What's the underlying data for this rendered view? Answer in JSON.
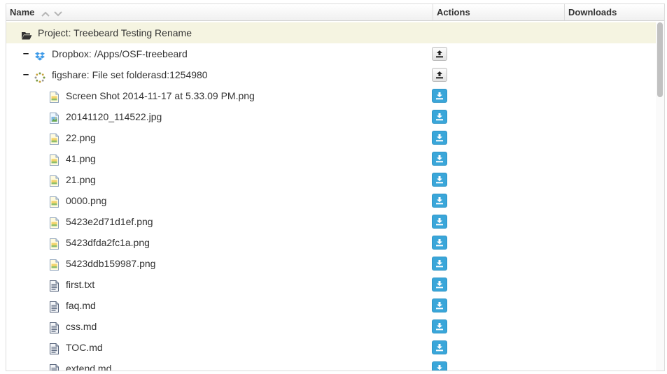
{
  "header": {
    "name": "Name",
    "actions": "Actions",
    "downloads": "Downloads",
    "sort_up_icon": "chevron-up-icon",
    "sort_down_icon": "chevron-down-icon"
  },
  "project": {
    "label": "Project: Treebeard Testing Rename",
    "icon": "folder-open-icon"
  },
  "providers": [
    {
      "label": "Dropbox: /Apps/OSF-treebeard",
      "toggle": "–",
      "icon": "dropbox-icon",
      "action": "upload-icon"
    },
    {
      "label": "figshare: File set folderasd:1254980",
      "toggle": "–",
      "icon": "figshare-icon",
      "action": "upload-icon"
    }
  ],
  "files": [
    {
      "label": "Screen Shot 2014-11-17 at 5.33.09 PM.png",
      "icon": "image-file-icon"
    },
    {
      "label": "20141120_114522.jpg",
      "icon": "photo-file-icon"
    },
    {
      "label": "22.png",
      "icon": "image-file-icon"
    },
    {
      "label": "41.png",
      "icon": "image-file-icon"
    },
    {
      "label": "21.png",
      "icon": "image-file-icon"
    },
    {
      "label": "0000.png",
      "icon": "image-file-icon"
    },
    {
      "label": "5423e2d71d1ef.png",
      "icon": "image-file-icon"
    },
    {
      "label": "5423dfda2fc1a.png",
      "icon": "image-file-icon"
    },
    {
      "label": "5423ddb159987.png",
      "icon": "image-file-icon"
    },
    {
      "label": "first.txt",
      "icon": "text-file-icon"
    },
    {
      "label": "faq.md",
      "icon": "text-file-icon"
    },
    {
      "label": "css.md",
      "icon": "text-file-icon"
    },
    {
      "label": "TOC.md",
      "icon": "text-file-icon"
    },
    {
      "label": "extend.md",
      "icon": "text-file-icon"
    }
  ],
  "colors": {
    "project_row_bg": "#f5f4e1",
    "download_button": "#3aa6d9",
    "upload_button": "#eeeeee"
  }
}
